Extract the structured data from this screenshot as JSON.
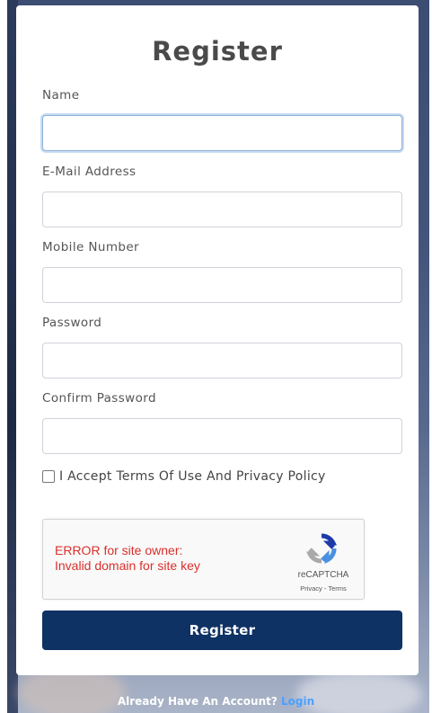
{
  "form": {
    "title": "Register",
    "fields": [
      {
        "label": "Name",
        "value": "",
        "placeholder": ""
      },
      {
        "label": "E-Mail Address",
        "value": "",
        "placeholder": ""
      },
      {
        "label": "Mobile Number",
        "value": "",
        "placeholder": ""
      },
      {
        "label": "Password",
        "value": "",
        "placeholder": ""
      },
      {
        "label": "Confirm Password",
        "value": "",
        "placeholder": ""
      }
    ],
    "terms_label": "I Accept Terms Of Use And Privacy Policy",
    "terms_checked": false,
    "submit_label": "Register"
  },
  "recaptcha": {
    "error_line1": "ERROR for site owner:",
    "error_line2": "Invalid domain for site key",
    "brand": "reCAPTCHA",
    "links": "Privacy - Terms",
    "icon": "recaptcha-logo-icon"
  },
  "footer": {
    "prompt": "Already Have An Account?",
    "login_link": "Login"
  },
  "colors": {
    "primary_button": "#0f3264",
    "login_link": "#4aa0ff",
    "error_text": "#d9302b",
    "focus_ring": "#8fb1d8"
  }
}
